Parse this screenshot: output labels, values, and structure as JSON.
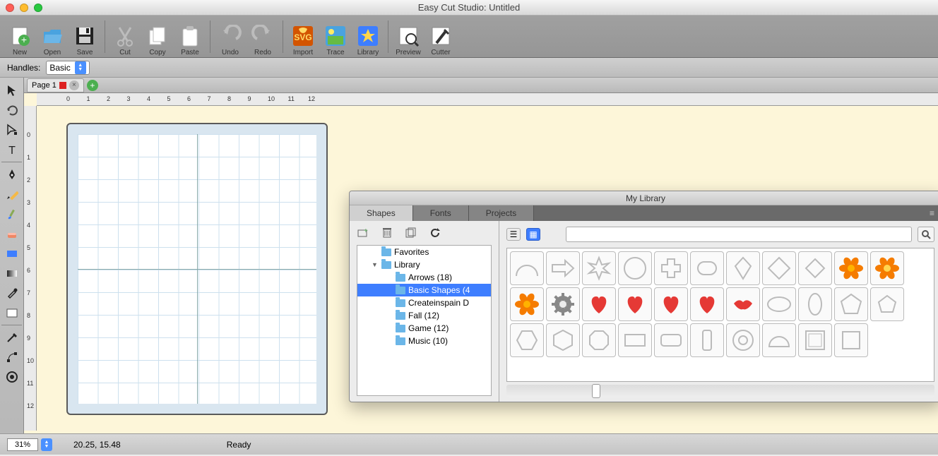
{
  "window_title": "Easy Cut Studio: Untitled",
  "toolbar": [
    {
      "label": "New",
      "icon": "new"
    },
    {
      "label": "Open",
      "icon": "open"
    },
    {
      "label": "Save",
      "icon": "save"
    },
    {
      "sep": true
    },
    {
      "label": "Cut",
      "icon": "cut"
    },
    {
      "label": "Copy",
      "icon": "copy"
    },
    {
      "label": "Paste",
      "icon": "paste"
    },
    {
      "sep": true
    },
    {
      "label": "Undo",
      "icon": "undo"
    },
    {
      "label": "Redo",
      "icon": "redo"
    },
    {
      "sep": true
    },
    {
      "label": "Import",
      "icon": "import"
    },
    {
      "label": "Trace",
      "icon": "trace"
    },
    {
      "label": "Library",
      "icon": "library"
    },
    {
      "sep": true
    },
    {
      "label": "Preview",
      "icon": "preview"
    },
    {
      "label": "Cutter",
      "icon": "cutter"
    }
  ],
  "options": {
    "handles_label": "Handles:",
    "handles_value": "Basic"
  },
  "page_tab": "Page 1",
  "ruler_h": [
    "0",
    "1",
    "2",
    "3",
    "4",
    "5",
    "6",
    "7",
    "8",
    "9",
    "10",
    "11",
    "12"
  ],
  "ruler_v": [
    "0",
    "1",
    "2",
    "3",
    "4",
    "5",
    "6",
    "7",
    "8",
    "9",
    "10",
    "11",
    "12"
  ],
  "tools_left": [
    "select",
    "rotate",
    "node",
    "text",
    "",
    "pen",
    "pencil",
    "brush",
    "eraser",
    "shape-rect",
    "gradient",
    "eyedropper",
    "swatch",
    "",
    "knife",
    "bezier",
    "grid-toggle"
  ],
  "library": {
    "title": "My Library",
    "tabs": [
      "Shapes",
      "Fonts",
      "Projects"
    ],
    "active_tab": 0,
    "tree": [
      {
        "label": "Favorites",
        "indent": 1
      },
      {
        "label": "Library",
        "indent": 1,
        "expanded": true
      },
      {
        "label": "Arrows (18)",
        "indent": 2
      },
      {
        "label": "Basic Shapes (4",
        "indent": 2,
        "selected": true
      },
      {
        "label": "Createinspain D",
        "indent": 2
      },
      {
        "label": "Fall (12)",
        "indent": 2
      },
      {
        "label": "Game (12)",
        "indent": 2
      },
      {
        "label": "Music (10)",
        "indent": 2
      }
    ],
    "shapes": [
      "arch",
      "arrow",
      "asterisk",
      "circle",
      "cross",
      "capsule",
      "kite",
      "diamond",
      "diamond2",
      "flower-orange",
      "flower-orange-yellow",
      "flower-orange-small",
      "gear",
      "heart",
      "heart2",
      "heart3",
      "heart-half",
      "lips",
      "ellipse",
      "oval-tall",
      "pentagon",
      "pentagon2",
      "hexagon",
      "hexagon2",
      "octagon",
      "rect",
      "rounded-rect",
      "rect-tall",
      "donut",
      "half-circle",
      "square-bevel",
      "square"
    ]
  },
  "status": {
    "zoom": "31%",
    "coords": "20.25, 15.48",
    "state": "Ready"
  }
}
